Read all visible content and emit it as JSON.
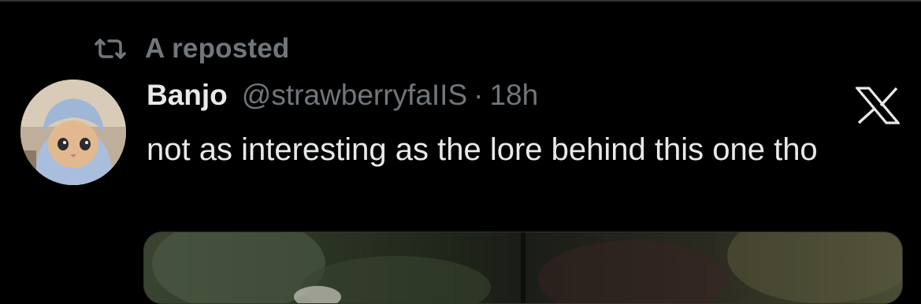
{
  "repost": {
    "icon": "repost-icon",
    "text": "A reposted"
  },
  "post": {
    "author": {
      "display_name": "Banjo",
      "handle": "@strawberryfaIIS",
      "avatar": "cat-wearing-blue-hood-avatar"
    },
    "separator": "·",
    "time": "18h",
    "text": "not as interesting as the lore behind this one tho",
    "platform_icon": "x-logo-icon",
    "media": "dark-photo-attachment"
  },
  "colors": {
    "background": "#000000",
    "primary_text": "#e7e9ea",
    "secondary_text": "#71767b",
    "divider": "#2f3336"
  }
}
